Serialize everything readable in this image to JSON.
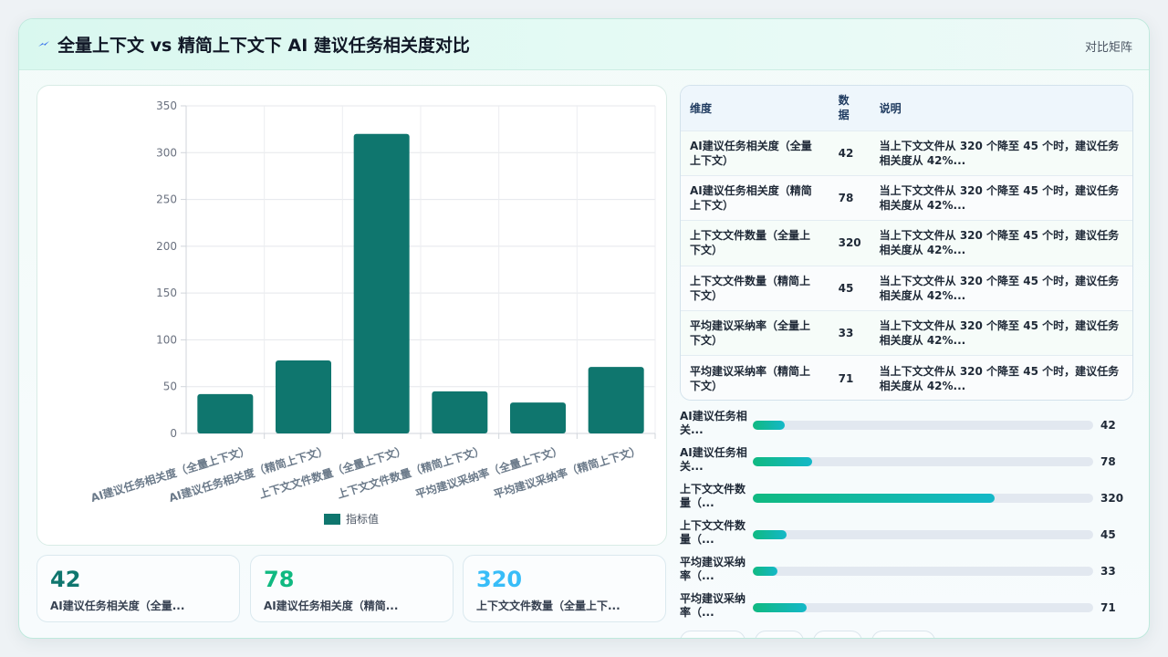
{
  "header": {
    "title": "全量上下文 vs 精简上下文下 AI 建议任务相关度对比",
    "right_label": "对比矩阵"
  },
  "colors": {
    "bar": "#0f766e",
    "accent_teal": "#0f766e",
    "accent_green": "#10b981",
    "accent_sky": "#38bdf8"
  },
  "chart_data": {
    "type": "bar",
    "categories": [
      "AI建议任务相关度（全量上下文）",
      "AI建议任务相关度（精简上下文）",
      "上下文文件数量（全量上下文）",
      "上下文文件数量（精简上下文）",
      "平均建议采纳率（全量上下文）",
      "平均建议采纳率（精简上下文）"
    ],
    "series": [
      {
        "name": "指标值",
        "values": [
          42,
          78,
          320,
          45,
          33,
          71
        ]
      }
    ],
    "ylim": [
      0,
      350
    ],
    "yticks": [
      0,
      50,
      100,
      150,
      200,
      250,
      300,
      350
    ],
    "grid": true,
    "legend": "bottom"
  },
  "stats": [
    {
      "value": "42",
      "label": "AI建议任务相关度（全量..."
    },
    {
      "value": "78",
      "label": "AI建议任务相关度（精简..."
    },
    {
      "value": "320",
      "label": "上下文文件数量（全量上下..."
    }
  ],
  "table": {
    "headers": [
      "维度",
      "数据",
      "说明"
    ],
    "rows": [
      {
        "dimension": "AI建议任务相关度（全量上下文）",
        "value": "42",
        "note": "当上下文文件从 320 个降至 45 个时，建议任务相关度从 42%..."
      },
      {
        "dimension": "AI建议任务相关度（精简上下文）",
        "value": "78",
        "note": "当上下文文件从 320 个降至 45 个时，建议任务相关度从 42%..."
      },
      {
        "dimension": "上下文文件数量（全量上下文）",
        "value": "320",
        "note": "当上下文文件从 320 个降至 45 个时，建议任务相关度从 42%..."
      },
      {
        "dimension": "上下文文件数量（精简上下文）",
        "value": "45",
        "note": "当上下文文件从 320 个降至 45 个时，建议任务相关度从 42%..."
      },
      {
        "dimension": "平均建议采纳率（全量上下文）",
        "value": "33",
        "note": "当上下文文件从 320 个降至 45 个时，建议任务相关度从 42%..."
      },
      {
        "dimension": "平均建议采纳率（精简上下文）",
        "value": "71",
        "note": "当上下文文件从 320 个降至 45 个时，建议任务相关度从 42%..."
      }
    ]
  },
  "progress": {
    "max": 450,
    "items": [
      {
        "label": "AI建议任务相关...",
        "value": 42
      },
      {
        "label": "AI建议任务相关...",
        "value": 78
      },
      {
        "label": "上下文文件数量（...",
        "value": 320
      },
      {
        "label": "上下文文件数量（...",
        "value": 45
      },
      {
        "label": "平均建议采纳率（...",
        "value": 33
      },
      {
        "label": "平均建议采纳率（...",
        "value": 71
      }
    ]
  }
}
